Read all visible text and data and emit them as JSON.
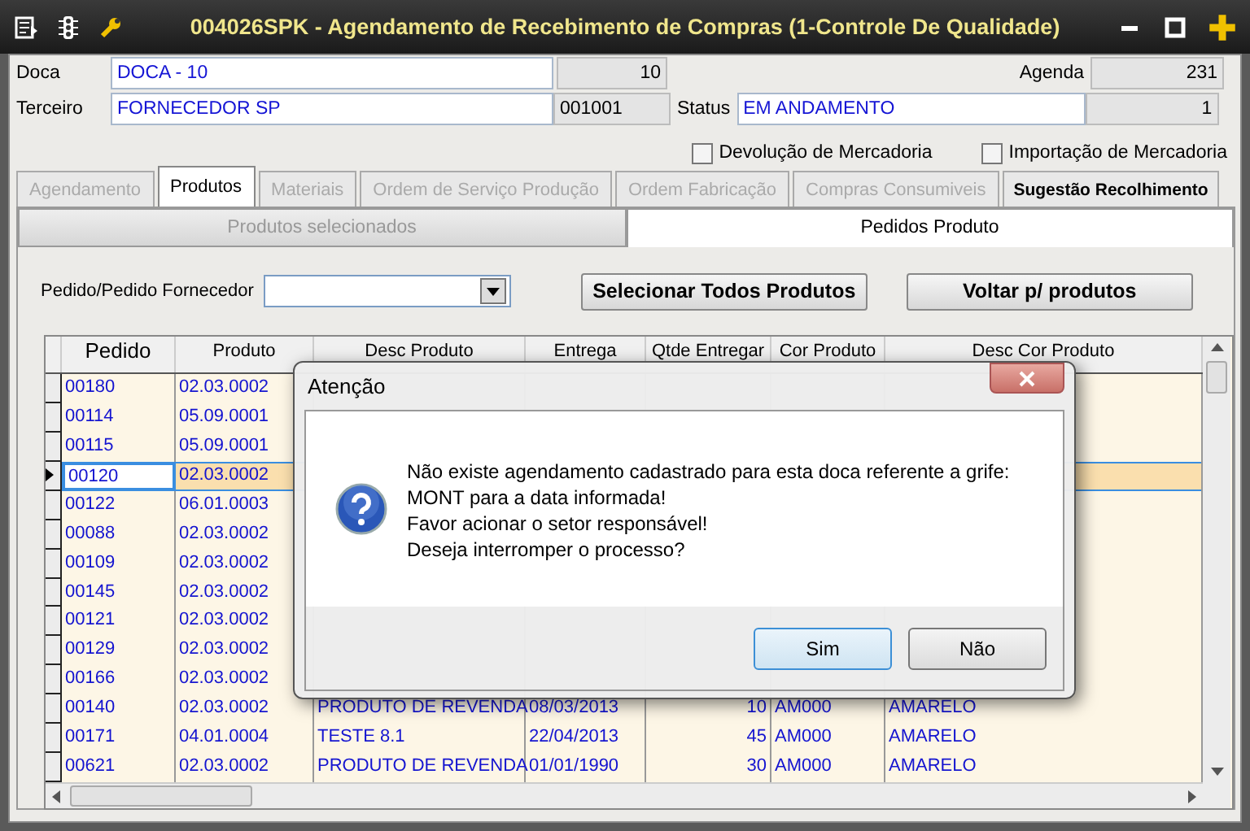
{
  "window": {
    "title": "004026SPK - Agendamento de Recebimento de Compras (1-Controle De Qualidade)"
  },
  "form": {
    "doca": {
      "label": "Doca",
      "value": "DOCA - 10",
      "code": "10"
    },
    "agenda": {
      "label": "Agenda",
      "value": "231"
    },
    "terceiro": {
      "label": "Terceiro",
      "value": "FORNECEDOR SP",
      "code": "001001"
    },
    "status": {
      "label": "Status",
      "value": "EM ANDAMENTO",
      "code": "1"
    },
    "checkboxes": [
      {
        "label": "Devolução de Mercadoria",
        "checked": false
      },
      {
        "label": "Importação de Mercadoria",
        "checked": false
      }
    ]
  },
  "tabs": [
    {
      "label": "Agendamento",
      "selected": false,
      "disabled": true
    },
    {
      "label": "Produtos",
      "selected": true,
      "disabled": false
    },
    {
      "label": "Materiais",
      "selected": false,
      "disabled": true
    },
    {
      "label": "Ordem de Serviço Produção",
      "selected": false,
      "disabled": true
    },
    {
      "label": "Ordem Fabricação",
      "selected": false,
      "disabled": true
    },
    {
      "label": "Compras Consumiveis",
      "selected": false,
      "disabled": true
    },
    {
      "label": "Sugestão Recolhimento",
      "selected": false,
      "disabled": false
    }
  ],
  "subtabs": [
    {
      "label": "Produtos selecionados",
      "selected": false,
      "disabled": true
    },
    {
      "label": "Pedidos Produto",
      "selected": true,
      "disabled": false
    }
  ],
  "filter": {
    "label": "Pedido/Pedido Fornecedor",
    "buttons": [
      "Selecionar Todos Produtos",
      "Voltar p/ produtos"
    ]
  },
  "table": {
    "columns": [
      "Pedido",
      "Produto",
      "Desc Produto",
      "Entrega",
      "Qtde Entregar",
      "Cor Produto",
      "Desc Cor Produto"
    ],
    "rows": [
      {
        "selected": false,
        "cells": [
          "00180",
          "02.03.0002"
        ]
      },
      {
        "selected": false,
        "cells": [
          "00114",
          "05.09.0001"
        ]
      },
      {
        "selected": false,
        "cells": [
          "00115",
          "05.09.0001"
        ]
      },
      {
        "selected": true,
        "cells": [
          "00120",
          "02.03.0002"
        ]
      },
      {
        "selected": false,
        "cells": [
          "00122",
          "06.01.0003"
        ]
      },
      {
        "selected": false,
        "cells": [
          "00088",
          "02.03.0002"
        ]
      },
      {
        "selected": false,
        "cells": [
          "00109",
          "02.03.0002"
        ]
      },
      {
        "selected": false,
        "cells": [
          "00145",
          "02.03.0002"
        ]
      },
      {
        "selected": false,
        "cells": [
          "00121",
          "02.03.0002"
        ]
      },
      {
        "selected": false,
        "cells": [
          "00129",
          "02.03.0002"
        ]
      },
      {
        "selected": false,
        "cells": [
          "00166",
          "02.03.0002"
        ]
      },
      {
        "selected": false,
        "cells": [
          "00140",
          "02.03.0002",
          "PRODUTO DE REVENDA",
          "08/03/2013",
          "10",
          "AM000",
          "AMARELO"
        ]
      },
      {
        "selected": false,
        "cells": [
          "00171",
          "04.01.0004",
          "TESTE 8.1",
          "22/04/2013",
          "45",
          "AM000",
          "AMARELO"
        ]
      },
      {
        "selected": false,
        "cells": [
          "00621",
          "02.03.0002",
          "PRODUTO DE REVENDA",
          "01/01/1990",
          "30",
          "AM000",
          "AMARELO"
        ]
      }
    ]
  },
  "dialog": {
    "title": "Atenção",
    "message": "Não existe agendamento cadastrado para esta doca referente a grife:\nMONT para a data informada!\nFavor acionar o setor responsável!\nDeseja interromper o processo?",
    "buttons": [
      {
        "label": "Sim",
        "selected": true
      },
      {
        "label": "Não",
        "selected": false
      }
    ]
  }
}
